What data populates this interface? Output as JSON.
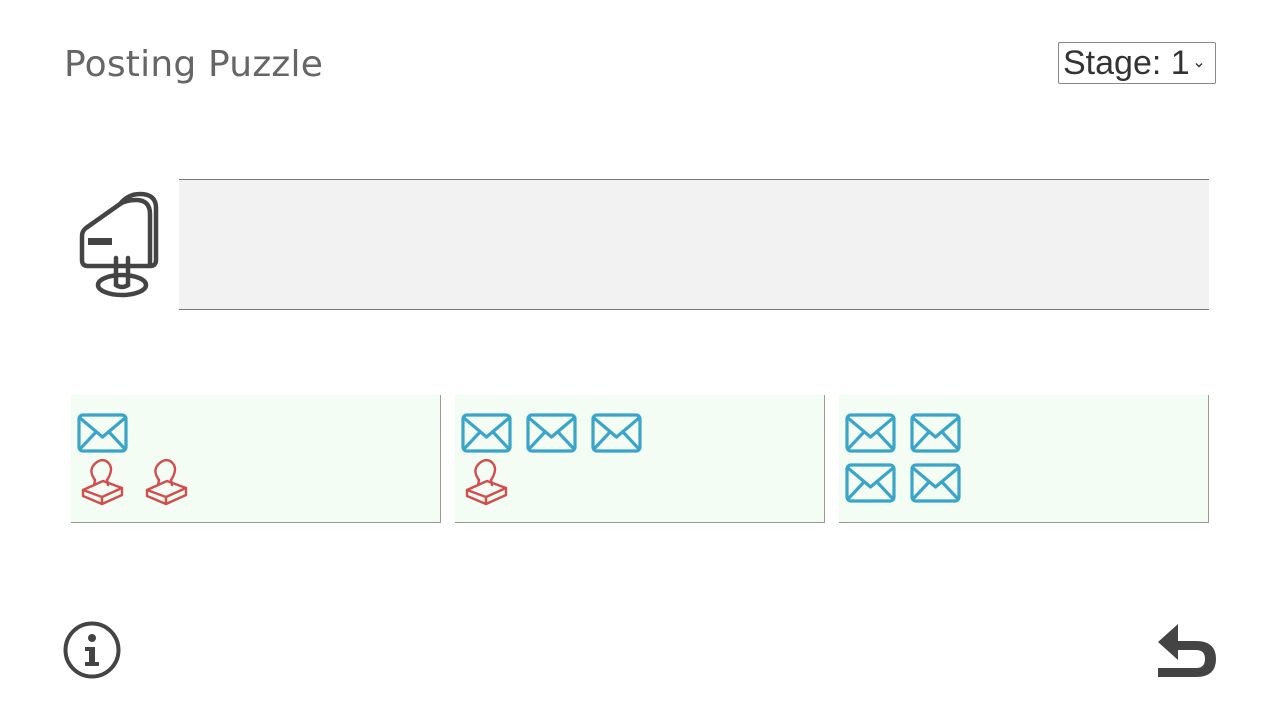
{
  "header": {
    "title": "Posting Puzzle",
    "stage_label": "Stage: 1"
  },
  "board": {
    "mailbox_icon": "mailbox-icon",
    "post_slot_contents": []
  },
  "bundles": [
    {
      "envelopes": 1,
      "stamps": 2
    },
    {
      "envelopes": 3,
      "stamps": 1
    },
    {
      "envelopes": 4,
      "stamps": 0
    }
  ],
  "footer": {
    "info_icon": "info-icon",
    "undo_icon": "undo-icon"
  },
  "colors": {
    "envelope": "#3aa4c9",
    "stamp": "#d44d4d",
    "bundle_bg": "#f3fdf3",
    "post_slot_bg": "#f2f2f2",
    "title": "#666666",
    "icon_dark": "#444444"
  }
}
